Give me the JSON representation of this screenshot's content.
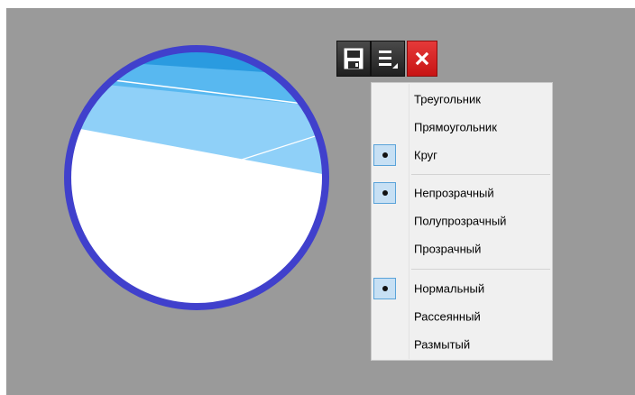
{
  "toolbar": {
    "save": {
      "icon": "floppy-disk-icon"
    },
    "menu": {
      "icon": "menu-lines-icon"
    },
    "close": {
      "icon": "close-x-icon",
      "color": "#d62020"
    }
  },
  "preview": {
    "shape": "circle",
    "border_color": "#4040cc",
    "sky_colors": [
      "#2a9be0",
      "#58b8f0",
      "#8fd0f8"
    ]
  },
  "context_menu": {
    "groups": [
      {
        "items": [
          {
            "label": "Треугольник",
            "checked": false
          },
          {
            "label": "Прямоугольник",
            "checked": false
          },
          {
            "label": "Круг",
            "checked": true
          }
        ]
      },
      {
        "items": [
          {
            "label": "Непрозрачный",
            "checked": true
          },
          {
            "label": "Полупрозрачный",
            "checked": false
          },
          {
            "label": "Прозрачный",
            "checked": false
          }
        ]
      },
      {
        "items": [
          {
            "label": "Нормальный",
            "checked": true
          },
          {
            "label": "Рассеянный",
            "checked": false
          },
          {
            "label": "Размытый",
            "checked": false
          }
        ]
      }
    ]
  }
}
